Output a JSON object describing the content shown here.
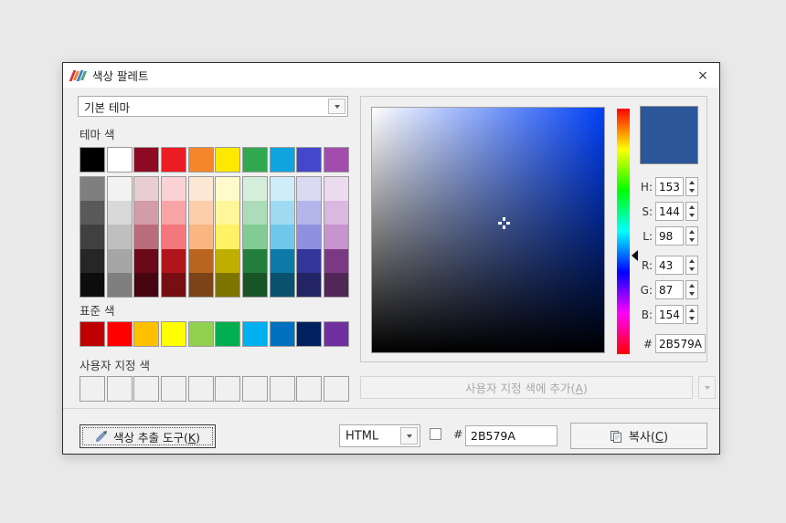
{
  "window": {
    "title": "색상 팔레트",
    "close_label": "×"
  },
  "theme_selector": {
    "value": "기본 테마"
  },
  "sections": {
    "theme": "테마 색",
    "standard": "표준 색",
    "custom": "사용자 지정 색"
  },
  "palette": {
    "theme_base": [
      "#000000",
      "#FFFFFF",
      "#8E0A22",
      "#EC1C24",
      "#F6862B",
      "#FFE800",
      "#2FA84F",
      "#0FA3E0",
      "#4447CC",
      "#A24DAE"
    ],
    "theme_tints": [
      [
        "#7F7F7F",
        "#F2F2F2",
        "#E8CED3",
        "#FBD2D3",
        "#FDE7D5",
        "#FFFACC",
        "#D5EEDC",
        "#CFEDF9",
        "#DADAF5",
        "#ECDBEF"
      ],
      [
        "#595959",
        "#D9D9D9",
        "#D29DA7",
        "#F7A4A7",
        "#FCCFAA",
        "#FFF699",
        "#ACDCB9",
        "#9FDAF3",
        "#B4B5EB",
        "#DAB8DF"
      ],
      [
        "#404040",
        "#BFBFBF",
        "#BB6C7A",
        "#F4777C",
        "#FAB680",
        "#FFF166",
        "#82CB95",
        "#6FC8EC",
        "#8F91E0",
        "#C794CE"
      ],
      [
        "#262626",
        "#A6A6A6",
        "#6B081A",
        "#B1151B",
        "#B96520",
        "#BFAE00",
        "#237E3B",
        "#0B7AA8",
        "#333599",
        "#7A3A83"
      ],
      [
        "#0D0D0D",
        "#7F7F7F",
        "#470511",
        "#760E12",
        "#7B4316",
        "#807400",
        "#185428",
        "#085270",
        "#222466",
        "#512757"
      ]
    ],
    "standard": [
      "#C00000",
      "#FF0000",
      "#FFC000",
      "#FFFF00",
      "#92D050",
      "#00B050",
      "#00B0F0",
      "#0070C0",
      "#002060",
      "#7030A0"
    ],
    "custom_count": 10
  },
  "picker": {
    "preview_color": "#2B579A",
    "gradient_hue_color": "#0040F8",
    "fields": [
      {
        "label": "H:",
        "value": "153"
      },
      {
        "label": "S:",
        "value": "144"
      },
      {
        "label": "L:",
        "value": "98"
      },
      {
        "label": "R:",
        "value": "43"
      },
      {
        "label": "G:",
        "value": "87"
      },
      {
        "label": "B:",
        "value": "154"
      }
    ],
    "hex_label": "#",
    "hex_value": "2B579A"
  },
  "add_button": {
    "pre": "사용자 지정 색에 추가(",
    "key": "A",
    "post": ")"
  },
  "footer": {
    "extract_button": {
      "pre": "색상 추출 도구(",
      "key": "K",
      "post": ")"
    },
    "format_combo_value": "HTML",
    "hash_label": "#",
    "hex_value": "2B579A",
    "copy_button": {
      "pre": "복사(",
      "key": "C",
      "post": ")"
    }
  },
  "icons": {
    "app": "hancom-logo-icon",
    "close": "close-icon",
    "combo_arrow": "chevron-down-icon",
    "spinner": "spinner-arrows-icon",
    "hue_marker": "hue-marker-triangle-icon",
    "crosshair": "crosshair-icon",
    "eyedropper": "eyedropper-icon",
    "copy": "copy-icon"
  },
  "colors": {
    "dialog_bg": "#F0F0F0",
    "titlebar_bg": "#FFFFFF",
    "page_bg": "#E9E9E9",
    "accent": "#2B579A",
    "swatch_border": "#9B9B9B",
    "control_border": "#ABABAB"
  }
}
